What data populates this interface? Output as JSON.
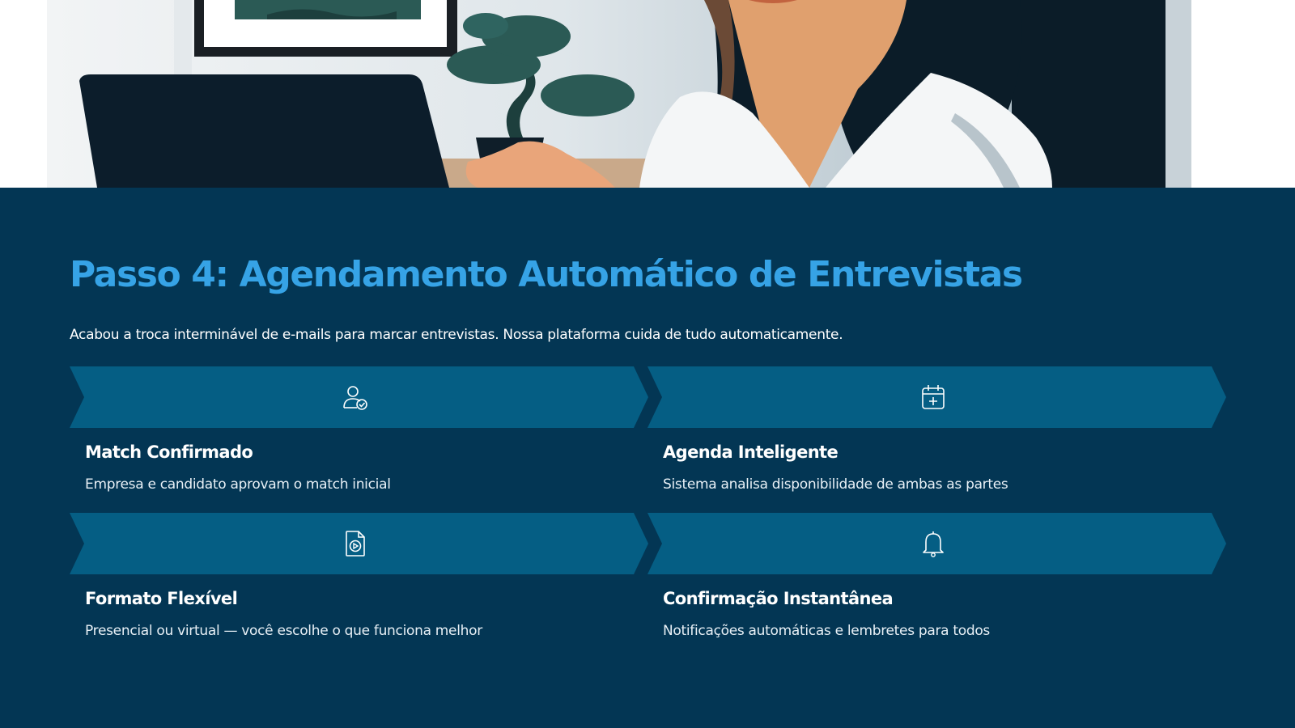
{
  "colors": {
    "background": "#033654",
    "accent_title": "#36a3e6",
    "chevron_fill": "#055e84",
    "text": "#ffffff"
  },
  "hero": {
    "image": "illustration-woman-at-desk-with-laptop-and-bonsai"
  },
  "header": {
    "title": "Passo 4: Agendamento Automático de Entrevistas",
    "subtitle": "Acabou a troca interminável de e-mails para marcar entrevistas. Nossa plataforma cuida de tudo automaticamente."
  },
  "steps": [
    {
      "icon": "user-check-icon",
      "title": "Match Confirmado",
      "description": "Empresa e candidato aprovam o match inicial"
    },
    {
      "icon": "calendar-plus-icon",
      "title": "Agenda Inteligente",
      "description": "Sistema analisa disponibilidade de ambas as partes"
    },
    {
      "icon": "file-play-icon",
      "title": "Formato Flexível",
      "description": "Presencial ou virtual — você escolhe o que funciona melhor"
    },
    {
      "icon": "bell-icon",
      "title": "Confirmação Instantânea",
      "description": "Notificações automáticas e lembretes para todos"
    }
  ]
}
